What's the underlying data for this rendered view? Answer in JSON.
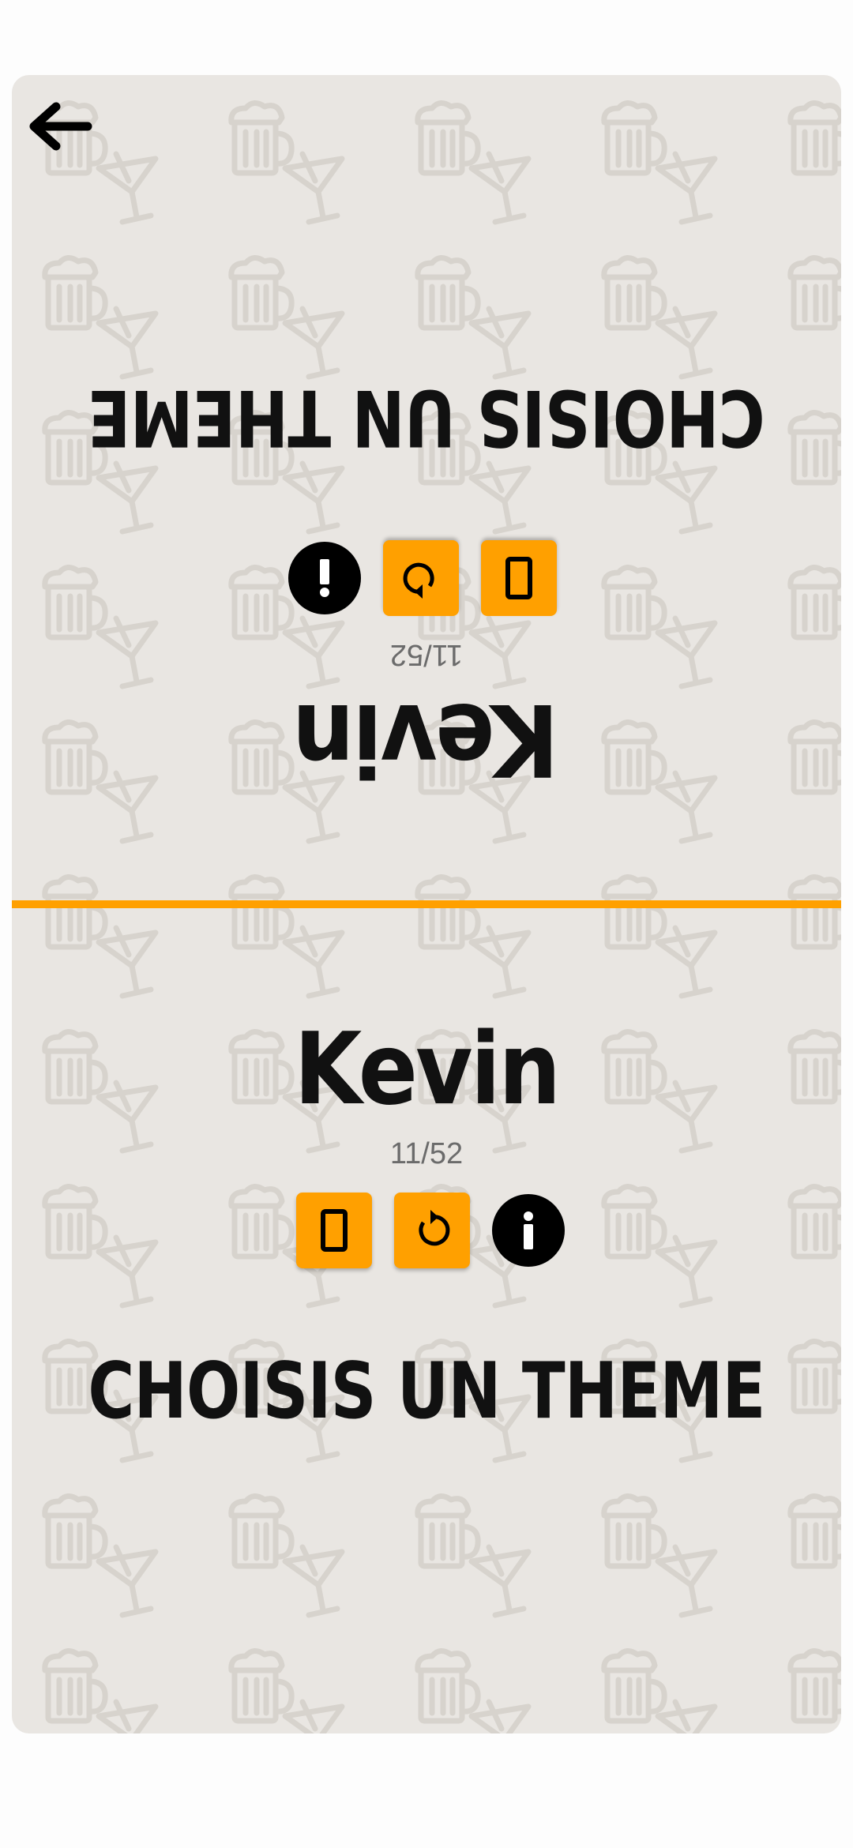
{
  "header": {
    "back_icon": "arrow-left-icon"
  },
  "colors": {
    "accent": "#ffa000",
    "card_bg": "#e9e6e2",
    "pattern": "#d6d2cc"
  },
  "top_panel": {
    "player_name": "Kevin",
    "progress": "11/52",
    "title": "CHOISIS UN THEME",
    "icons": [
      "phone-icon",
      "rotate-icon",
      "info-icon"
    ]
  },
  "bottom_panel": {
    "player_name": "Kevin",
    "progress": "11/52",
    "title": "CHOISIS UN THEME",
    "icons": [
      "phone-icon",
      "rotate-icon",
      "info-icon"
    ]
  },
  "background_pattern": [
    "beer-mug-icon",
    "cocktail-glass-icon"
  ]
}
